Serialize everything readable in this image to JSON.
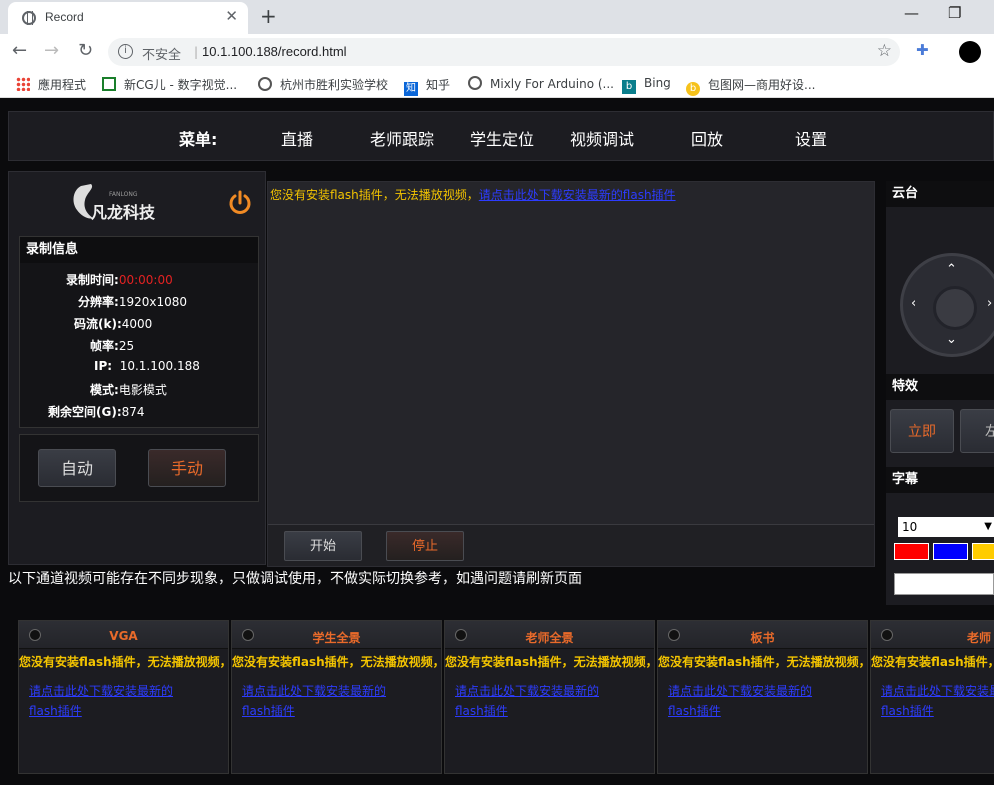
{
  "browser": {
    "tab_title": "Record",
    "tab_close": "✕",
    "new_tab": "+",
    "minimize": "—",
    "restore": "❐",
    "back": "←",
    "forward": "→",
    "reload": "↻",
    "info_icon": "i",
    "insecure_label": "不安全",
    "separator": "|",
    "url": "10.1.100.188/record.html",
    "star": "☆",
    "extension_icon": "✚",
    "bookmarks": [
      {
        "label": "應用程式",
        "icon": "apps-icon"
      },
      {
        "label": "新CG儿 - 数字视觉...",
        "icon": "cg-icon"
      },
      {
        "label": "杭州市胜利实验学校",
        "icon": "globe-icon"
      },
      {
        "label": "知乎",
        "icon": "zhihu-icon",
        "glyph": "知"
      },
      {
        "label": "Mixly For Arduino (...",
        "icon": "globe-icon"
      },
      {
        "label": "Bing",
        "icon": "bing-icon",
        "glyph": "b"
      },
      {
        "label": "包图网—商用好设...",
        "icon": "baotu-icon",
        "glyph": "b"
      }
    ]
  },
  "menu": {
    "label": "菜单:",
    "items": [
      "直播",
      "老师跟踪",
      "学生定位",
      "视频调试",
      "回放",
      "设置"
    ]
  },
  "logo": {
    "name": "凡龙科技",
    "sub": "FANLONG"
  },
  "record_info": {
    "title": "录制信息",
    "time_label": "录制时间:",
    "time_value": "00:00:00",
    "resolution_label": "分辨率:",
    "resolution_value": "1920x1080",
    "bitrate_label": "码流(k):",
    "bitrate_value": "4000",
    "fps_label": "帧率:",
    "fps_value": "25",
    "ip_label": "IP:",
    "ip_value": "10.1.100.188",
    "mode_label": "模式:",
    "mode_value": "电影模式",
    "space_label": "剩余空间(G):",
    "space_value": "874"
  },
  "mode_buttons": {
    "auto": "自动",
    "manual": "手动"
  },
  "video": {
    "flash_msg": "您没有安装flash插件，无法播放视频，",
    "flash_link": "请点击此处下载安装最新的flash插件",
    "start": "开始",
    "stop": "停止"
  },
  "right_panel": {
    "ptz_title": "云台",
    "ptz_up": "⌃",
    "ptz_down": "⌄",
    "ptz_left": "‹",
    "ptz_right": "›",
    "fx_title": "特效",
    "fx_now": "立即",
    "fx_left": "左",
    "subtitle_title": "字幕",
    "subtitle_size": "10",
    "subtitle_arrow": "▼",
    "swatch_colors": [
      "#ff0000",
      "#0000ff",
      "#ffcc00"
    ]
  },
  "notice": "以下通道视频可能存在不同步现象，只做调试使用，不做实际切换参考，如遇问题请刷新页面",
  "channels": [
    {
      "title": "VGA",
      "msg": "您没有安装flash插件，无法播放视频，",
      "link": "请点击此处下载安装最新的flash插件"
    },
    {
      "title": "学生全景",
      "msg": "您没有安装flash插件，无法播放视频，",
      "link": "请点击此处下载安装最新的flash插件"
    },
    {
      "title": "老师全景",
      "msg": "您没有安装flash插件，无法播放视频，",
      "link": "请点击此处下载安装最新的flash插件"
    },
    {
      "title": "板书",
      "msg": "您没有安装flash插件，无法播放视频，",
      "link": "请点击此处下载安装最新的flash插件"
    },
    {
      "title": "老师",
      "msg": "您没有安装flash插件，",
      "link": "请点击此处下载安装最新的flash插件"
    }
  ]
}
